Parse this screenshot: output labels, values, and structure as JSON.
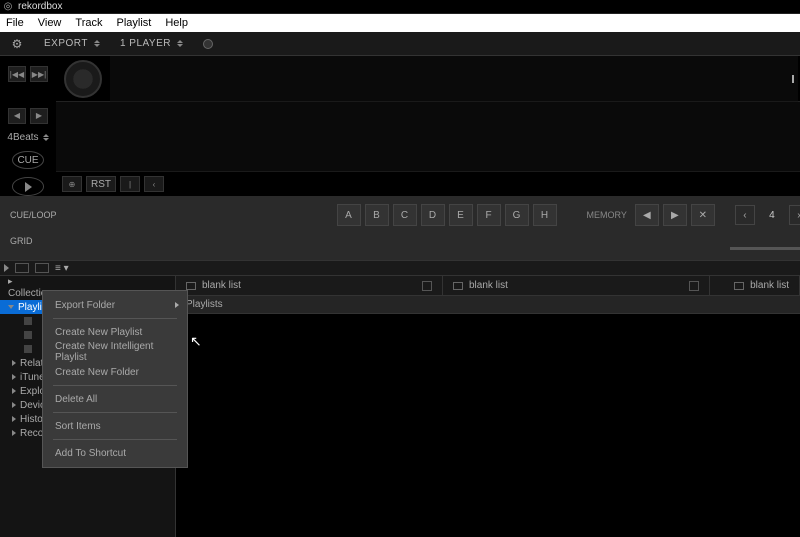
{
  "titlebar": {
    "app": "rekordbox"
  },
  "menubar": {
    "items": [
      "File",
      "View",
      "Track",
      "Playlist",
      "Help"
    ]
  },
  "toolbar": {
    "export": "EXPORT",
    "player": "1 PLAYER"
  },
  "deck": {
    "beats": "4Beats",
    "rst": "RST",
    "cue": "CUE"
  },
  "cueloop": {
    "row1": "CUE/LOOP",
    "row2": "GRID",
    "hotcues": [
      "A",
      "B",
      "C",
      "D",
      "E",
      "F",
      "G",
      "H"
    ],
    "memory": "MEMORY",
    "pagenum": "4"
  },
  "tree": {
    "collection": "Collection",
    "playlists": "Playlists",
    "related": "Related Tracks",
    "itunes": "iTunes",
    "explorer": "Explorer",
    "devices": "Devices",
    "histories": "Histories",
    "recordings": "Recordings"
  },
  "tabs": {
    "blank": "blank list"
  },
  "subhead": {
    "playlists": "Playlists"
  },
  "context": {
    "export_folder": "Export Folder",
    "create_playlist": "Create New Playlist",
    "create_intelligent": "Create New Intelligent Playlist",
    "create_folder": "Create New Folder",
    "delete_all": "Delete All",
    "sort_items": "Sort Items",
    "add_shortcut": "Add To Shortcut"
  }
}
